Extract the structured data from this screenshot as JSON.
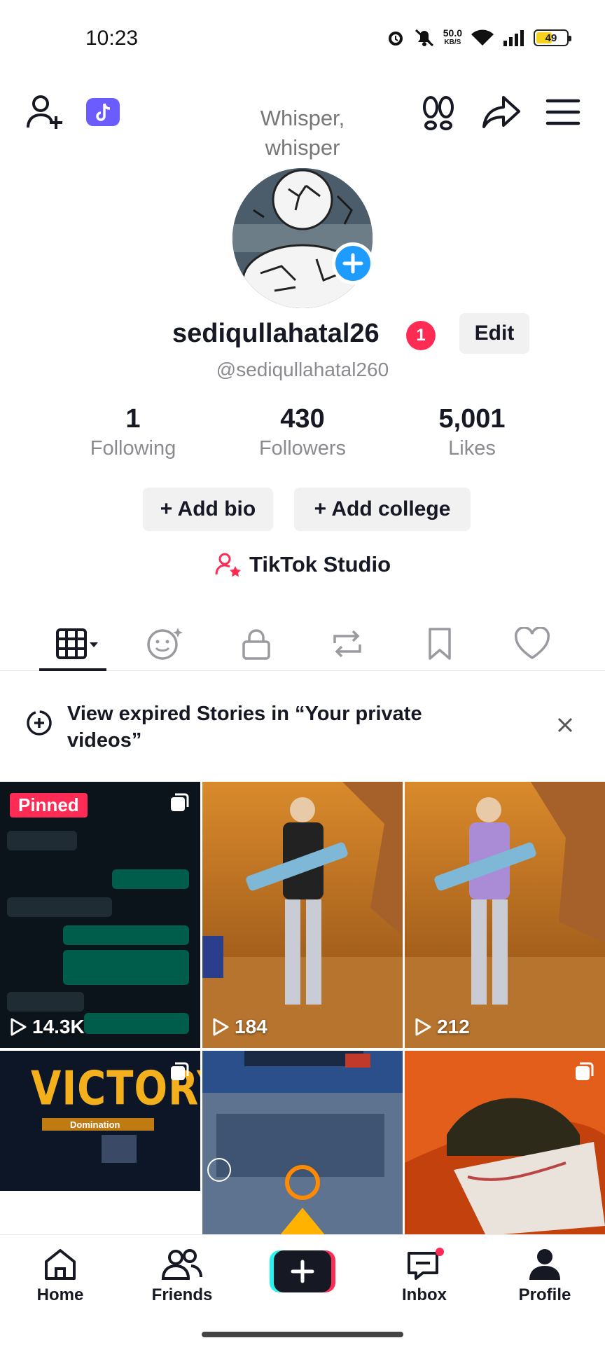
{
  "status_bar": {
    "time": "10:23",
    "net_speed_value": "50.0",
    "net_speed_unit": "KB/S",
    "battery": "49"
  },
  "story_note": {
    "line1": "Whisper,",
    "line2": "whisper"
  },
  "profile": {
    "username": "sediqullahatal26",
    "notification_count": "1",
    "edit_label": "Edit",
    "handle": "@sediqullahatal260"
  },
  "stats": [
    {
      "value": "1",
      "label": "Following"
    },
    {
      "value": "430",
      "label": "Followers"
    },
    {
      "value": "5,001",
      "label": "Likes"
    }
  ],
  "chips": {
    "add_bio": "+ Add bio",
    "add_college": "+ Add college"
  },
  "studio": {
    "label": "TikTok Studio"
  },
  "tabs": [
    "grid-icon",
    "reposts-smile-icon",
    "lock-icon",
    "repost-icon",
    "bookmark-icon",
    "heart-icon"
  ],
  "banner": {
    "text": "View expired Stories in “Your private videos”"
  },
  "videos": [
    {
      "pinned_label": "Pinned",
      "views": "14.3K"
    },
    {
      "views": "184"
    },
    {
      "views": "212"
    },
    {
      "overlay_text": "VICTORY",
      "sub_text": "Domination"
    },
    {
      "overlay_text": ""
    },
    {
      "overlay_text": ""
    }
  ],
  "bottom_nav": {
    "home": "Home",
    "friends": "Friends",
    "inbox": "Inbox",
    "profile": "Profile"
  },
  "colors": {
    "accent_red": "#fe2c55",
    "accent_blue": "#1e9bff",
    "text_primary": "#161823",
    "text_secondary": "#8a8b91"
  }
}
